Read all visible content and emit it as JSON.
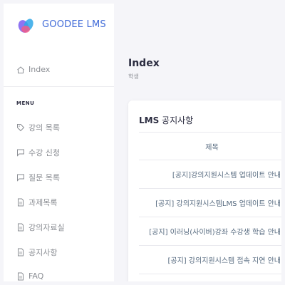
{
  "brand": {
    "name": "GOODEE LMS"
  },
  "sidebar": {
    "index_label": "Index",
    "menu_header": "MENU",
    "items": [
      {
        "label": "강의 목록",
        "icon": "tag-icon"
      },
      {
        "label": "수강 신청",
        "icon": "chat-icon"
      },
      {
        "label": "질문 목록",
        "icon": "chat-icon"
      },
      {
        "label": "과제목록",
        "icon": "file-icon"
      },
      {
        "label": "강의자료실",
        "icon": "file-icon"
      },
      {
        "label": "공지사항",
        "icon": "file-icon"
      },
      {
        "label": "FAQ",
        "icon": "file-icon"
      }
    ]
  },
  "header": {
    "title": "Index",
    "subtitle": "학생"
  },
  "notice_card": {
    "title_bold": "LMS",
    "title_rest": " 공지사항",
    "column_header": "제목",
    "rows": [
      "[공지]강의지원시스템 업데이트 안내",
      "[공지] 강의지원시스템LMS 업데이트 안내",
      "[공지] 이러닝(사이버)강좌 수강생 학습 안내",
      "[공지] 강의지원시스템 접속 지연 안내"
    ]
  },
  "colors": {
    "accent": "#3f6ad8",
    "background": "#f5f5f9",
    "text": "#566a7f"
  }
}
